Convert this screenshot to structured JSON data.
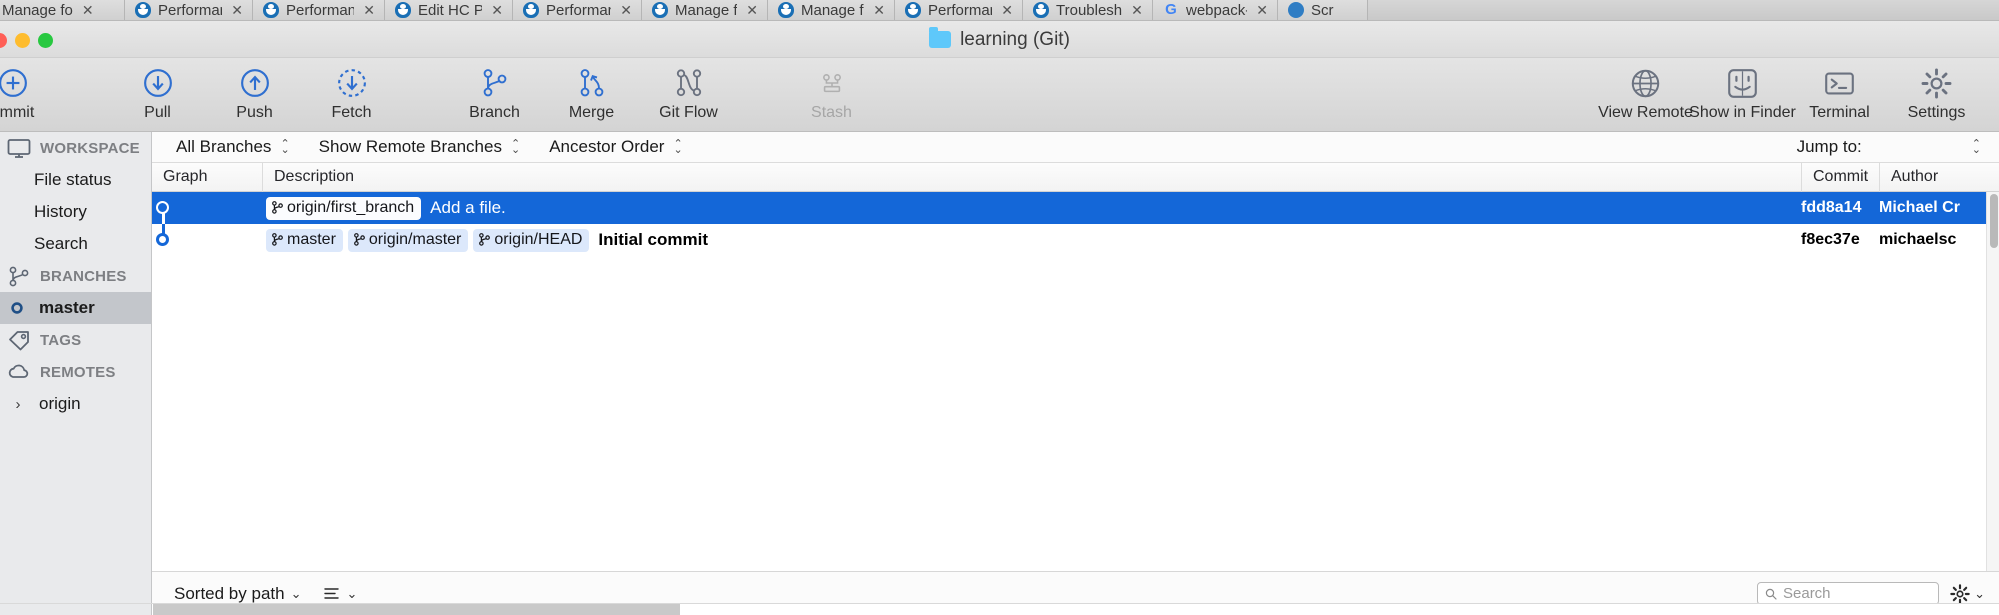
{
  "browser_tabs": [
    {
      "label": "Manage fo",
      "fade": "",
      "favicon": "none-icon",
      "first": true
    },
    {
      "label": "Performan",
      "fade": "",
      "favicon": "drupal-favicon"
    },
    {
      "label": "Performan",
      "fade": "",
      "favicon": "drupal-favicon"
    },
    {
      "label": "Edit HC Pa",
      "fade": "",
      "favicon": "drupal-favicon"
    },
    {
      "label": "Performan",
      "fade": "",
      "favicon": "drupal-favicon"
    },
    {
      "label": "Manage fo",
      "fade": "",
      "favicon": "drupal-favicon"
    },
    {
      "label": "Manage fo",
      "fade": "",
      "favicon": "drupal-favicon"
    },
    {
      "label": "Performan",
      "fade": "",
      "favicon": "drupal-favicon"
    },
    {
      "label": "Troublesh",
      "fade": "",
      "favicon": "drupal-favicon"
    },
    {
      "label": "webpack-c",
      "fade": "",
      "favicon": "google-favicon"
    },
    {
      "label": "Scr",
      "fade": "",
      "favicon": "blue-circle-favicon"
    }
  ],
  "window": {
    "title": "learning (Git)",
    "folder_icon": "folder-icon"
  },
  "toolbar": {
    "left_items": [
      {
        "label": "ommit",
        "icon": "plus-circle-icon",
        "disabled": false
      },
      {
        "label": "Pull",
        "icon": "arrow-down-circle-icon",
        "disabled": false
      },
      {
        "label": "Push",
        "icon": "arrow-up-circle-icon",
        "disabled": false
      },
      {
        "label": "Fetch",
        "icon": "arrow-down-dashed-circle-icon",
        "disabled": false
      },
      {
        "label": "Branch",
        "icon": "branch-icon",
        "disabled": false
      },
      {
        "label": "Merge",
        "icon": "merge-icon",
        "disabled": false
      },
      {
        "label": "Git Flow",
        "icon": "gitflow-icon",
        "disabled": false
      },
      {
        "label": "Stash",
        "icon": "stash-icon",
        "disabled": true
      }
    ],
    "right_items": [
      {
        "label": "View Remote",
        "icon": "globe-icon",
        "disabled": false
      },
      {
        "label": "Show in Finder",
        "icon": "finder-icon",
        "disabled": false
      },
      {
        "label": "Terminal",
        "icon": "terminal-icon",
        "disabled": false
      },
      {
        "label": "Settings",
        "icon": "gear-icon",
        "disabled": false
      }
    ]
  },
  "sidebar": {
    "groups": [
      {
        "section": "WORKSPACE",
        "icon": "monitor-icon",
        "items": [
          {
            "label": "File status",
            "selected": false
          },
          {
            "label": "History",
            "selected": false
          },
          {
            "label": "Search",
            "selected": false
          }
        ]
      },
      {
        "section": "BRANCHES",
        "icon": "branch-icon",
        "items": [
          {
            "label": "master",
            "selected": true,
            "icon": "branch-node-icon"
          }
        ]
      },
      {
        "section": "TAGS",
        "icon": "tag-icon",
        "items": []
      },
      {
        "section": "REMOTES",
        "icon": "cloud-icon",
        "items": [
          {
            "label": "origin",
            "selected": false,
            "icon": "chevron-right-icon"
          }
        ]
      }
    ]
  },
  "filter_bar": {
    "selects": [
      {
        "value": "All Branches"
      },
      {
        "value": "Show Remote Branches"
      },
      {
        "value": "Ancestor Order"
      }
    ],
    "jump_to_label": "Jump to:"
  },
  "table": {
    "columns": [
      "Graph",
      "Description",
      "Commit",
      "Author"
    ],
    "rows": [
      {
        "selected": true,
        "refs": [
          "origin/first_branch"
        ],
        "message": "Add a file.",
        "message_bold": false,
        "commit": "fdd8a14",
        "author": "Michael Cr"
      },
      {
        "selected": false,
        "refs": [
          "master",
          "origin/master",
          "origin/HEAD"
        ],
        "message": "Initial commit",
        "message_bold": true,
        "commit": "f8ec37e",
        "author": "michaelsc"
      }
    ]
  },
  "bottom_bar": {
    "sort_label": "Sorted by path",
    "list_mode_icon": "list-view-icon",
    "search_placeholder": "Search",
    "search_value": "",
    "gear_icon": "gear-icon"
  },
  "colors": {
    "selection_blue": "#1467d8",
    "ref_tag_bg": "#dce8fb",
    "toolbar_icon": "#2f6fd0",
    "sidebar_bg": "#e9eaec"
  }
}
